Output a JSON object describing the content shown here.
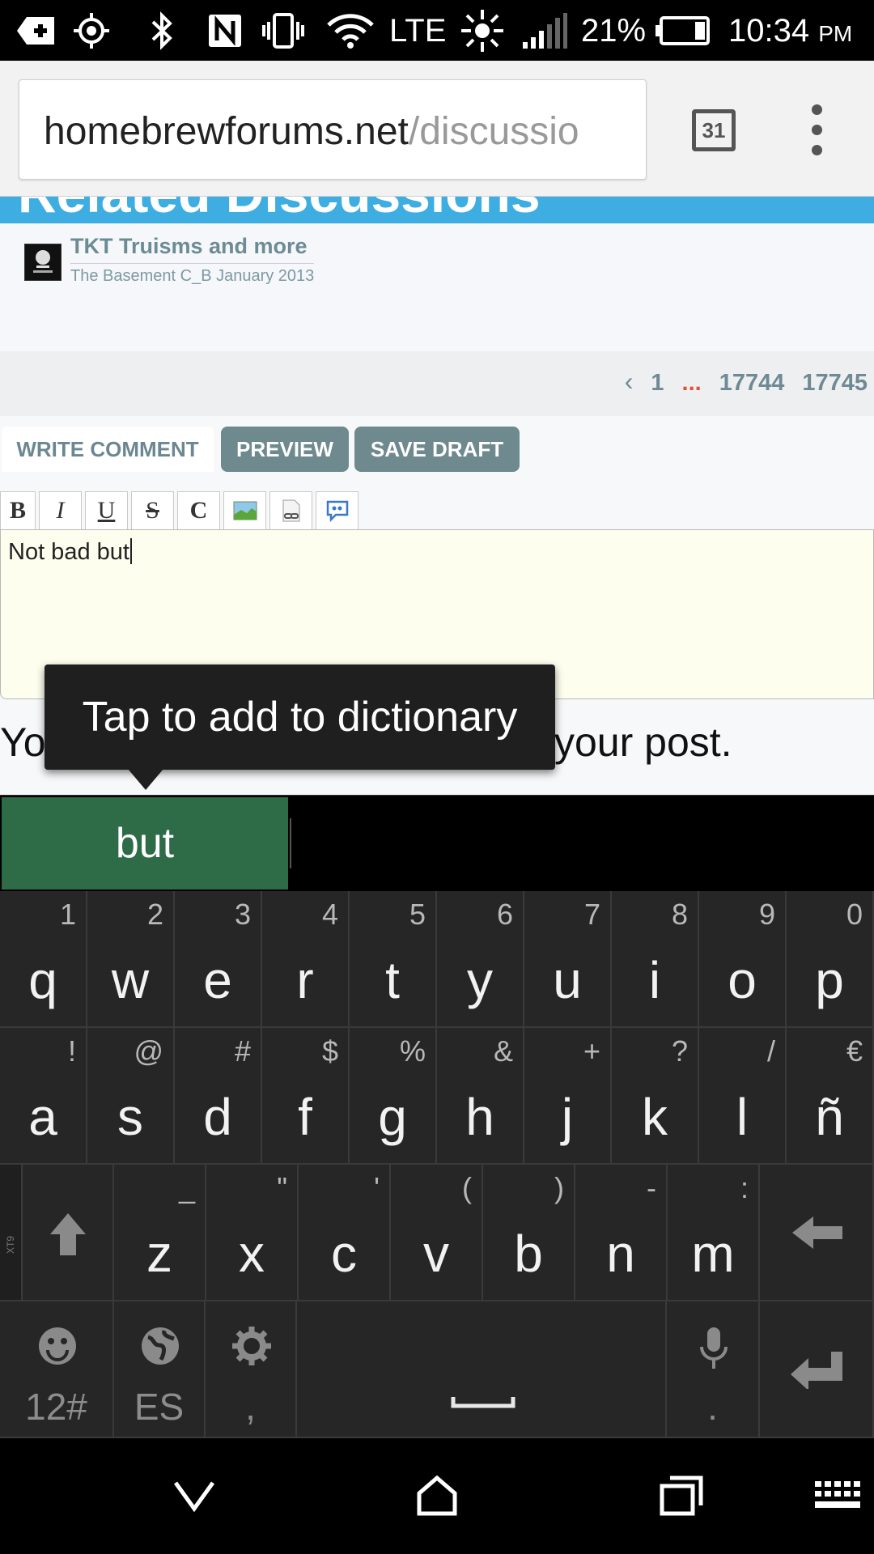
{
  "status_bar": {
    "network": "LTE",
    "battery": "21%",
    "time": "10:34",
    "ampm": "PM"
  },
  "browser": {
    "url_host": "homebrewforums.net",
    "url_path": "/discussio",
    "tab_count": "31"
  },
  "page": {
    "banner_text": "Related Discussions",
    "related": {
      "title": "TKT Truisms and more",
      "meta": "The Basement C_B January 2013"
    },
    "pager": {
      "prev": "‹",
      "first": "1",
      "ellipsis": "...",
      "page_a": "17744",
      "page_b": "17745"
    },
    "tabs": {
      "write": "WRITE COMMENT",
      "preview": "PREVIEW",
      "save_draft": "SAVE DRAFT"
    },
    "toolbar": [
      "B",
      "I",
      "U",
      "S",
      "C"
    ],
    "editor_text": "Not bad but",
    "note_left": "Yo",
    "note_right": "your post."
  },
  "tooltip": {
    "text": "Tap to add to dictionary"
  },
  "suggestion": {
    "word": "but"
  },
  "keyboard": {
    "row1": [
      {
        "key": "q",
        "hint": "1"
      },
      {
        "key": "w",
        "hint": "2"
      },
      {
        "key": "e",
        "hint": "3"
      },
      {
        "key": "r",
        "hint": "4"
      },
      {
        "key": "t",
        "hint": "5"
      },
      {
        "key": "y",
        "hint": "6"
      },
      {
        "key": "u",
        "hint": "7"
      },
      {
        "key": "i",
        "hint": "8"
      },
      {
        "key": "o",
        "hint": "9"
      },
      {
        "key": "p",
        "hint": "0"
      }
    ],
    "row2": [
      {
        "key": "a",
        "hint": "!"
      },
      {
        "key": "s",
        "hint": "@"
      },
      {
        "key": "d",
        "hint": "#"
      },
      {
        "key": "f",
        "hint": "$"
      },
      {
        "key": "g",
        "hint": "%"
      },
      {
        "key": "h",
        "hint": "&"
      },
      {
        "key": "j",
        "hint": "+"
      },
      {
        "key": "k",
        "hint": "?"
      },
      {
        "key": "l",
        "hint": "/"
      },
      {
        "key": "ñ",
        "hint": "€"
      }
    ],
    "row3": [
      {
        "key": "z",
        "hint": "_"
      },
      {
        "key": "x",
        "hint": "\""
      },
      {
        "key": "c",
        "hint": "'"
      },
      {
        "key": "v",
        "hint": "("
      },
      {
        "key": "b",
        "hint": ")"
      },
      {
        "key": "n",
        "hint": "-"
      },
      {
        "key": "m",
        "hint": ":"
      }
    ],
    "xt9_label": "XT9",
    "symbols_label": "12#",
    "language_label": "ES",
    "comma_label": ",",
    "period_label": "."
  }
}
